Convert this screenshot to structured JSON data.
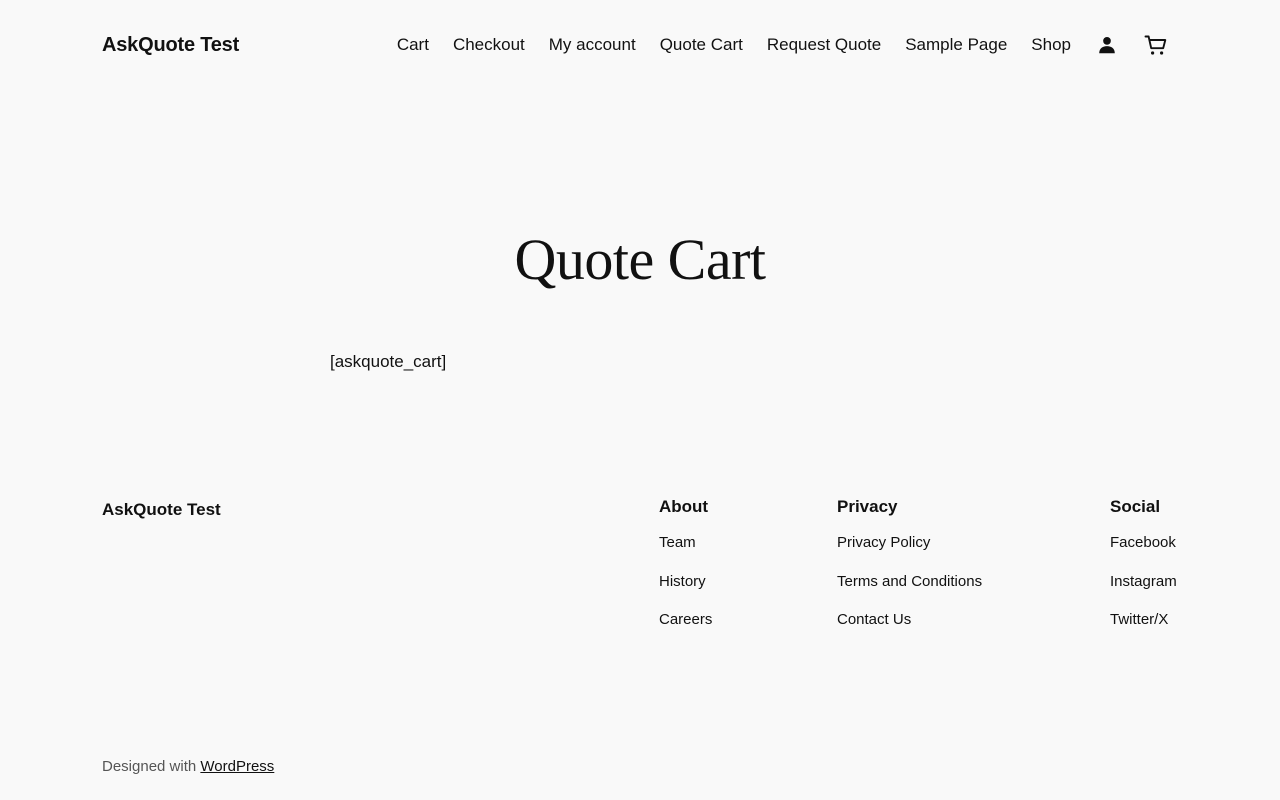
{
  "header": {
    "site_title": "AskQuote Test",
    "nav": [
      {
        "label": "Cart"
      },
      {
        "label": "Checkout"
      },
      {
        "label": "My account"
      },
      {
        "label": "Quote Cart"
      },
      {
        "label": "Request Quote"
      },
      {
        "label": "Sample Page"
      },
      {
        "label": "Shop"
      }
    ],
    "icons": {
      "account": "user-account-icon",
      "cart": "shopping-cart-icon"
    }
  },
  "main": {
    "title": "Quote Cart",
    "content": "[askquote_cart]"
  },
  "footer": {
    "site_title": "AskQuote Test",
    "columns": [
      {
        "heading": "About",
        "links": [
          "Team",
          "History",
          "Careers"
        ]
      },
      {
        "heading": "Privacy",
        "links": [
          "Privacy Policy",
          "Terms and Conditions",
          "Contact Us"
        ]
      },
      {
        "heading": "Social",
        "links": [
          "Facebook",
          "Instagram",
          "Twitter/X"
        ]
      }
    ],
    "credits_prefix": "Designed with",
    "credits_link": "WordPress"
  },
  "colors": {
    "background": "#f9f9f9",
    "text": "#111111",
    "muted": "#555555"
  }
}
